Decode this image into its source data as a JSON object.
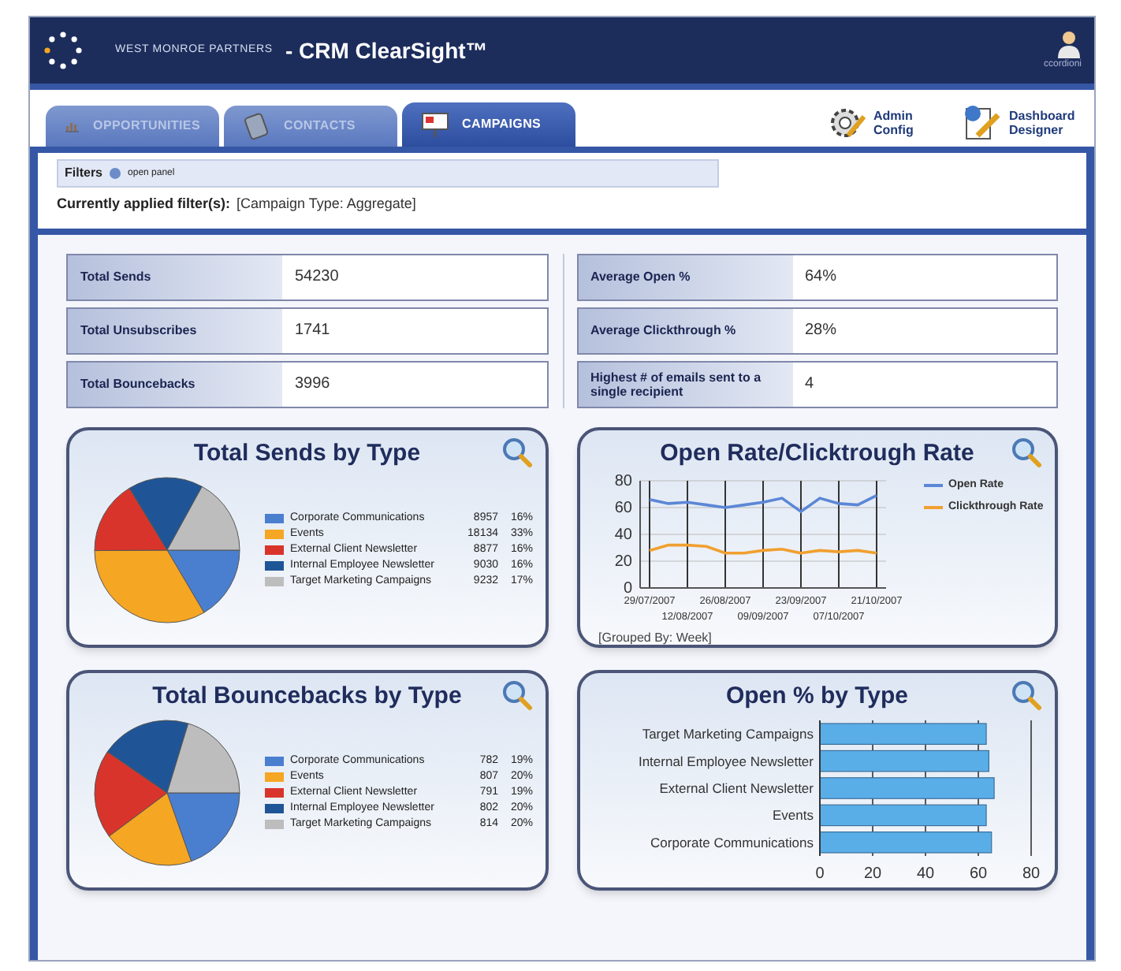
{
  "header": {
    "company": "WEST MONROE PARTNERS",
    "product": "- CRM ClearSight™",
    "user": "ccordioni"
  },
  "tabs": [
    {
      "label": "OPPORTUNITIES",
      "selected": false
    },
    {
      "label": "CONTACTS",
      "selected": false
    },
    {
      "label": "CAMPAIGNS",
      "selected": true
    }
  ],
  "tools": [
    {
      "label": "Admin Config",
      "kind": "gear"
    },
    {
      "label": "Dashboard Designer",
      "kind": "designer"
    }
  ],
  "filters": {
    "title": "Filters",
    "toggle": "open panel",
    "applied_label": "Currently applied filter(s):",
    "applied_value": "[Campaign Type: Aggregate]"
  },
  "stats_left": [
    {
      "label": "Total Sends",
      "value": "54230"
    },
    {
      "label": "Total Unsubscribes",
      "value": "1741"
    },
    {
      "label": "Total Bouncebacks",
      "value": "3996"
    }
  ],
  "stats_right": [
    {
      "label": "Average Open %",
      "value": "64%"
    },
    {
      "label": "Average Clickthrough %",
      "value": "28%"
    },
    {
      "label": "Highest # of emails sent to a single recipient",
      "value": "4"
    }
  ],
  "charts": [
    {
      "chart_data": {
        "type": "pie",
        "title": "Total Sends by Type",
        "legend": "right",
        "categories": [
          "Corporate Communications",
          "Events",
          "External Client Newsletter",
          "Internal Employee Newsletter",
          "Target Marketing Campaigns"
        ],
        "values": [
          16.5,
          33.4,
          16.4,
          16.7,
          17.0
        ],
        "colors": [
          "#4a7fd0",
          "#f5a623",
          "#d9342b",
          "#1f5596",
          "#bdbdbd"
        ]
      },
      "legend_values": [
        {
          "count": "8957",
          "share": "16%"
        },
        {
          "count": "18134",
          "share": "33%"
        },
        {
          "count": "8877",
          "share": "16%"
        },
        {
          "count": "9030",
          "share": "16%"
        },
        {
          "count": "9232",
          "share": "17%"
        }
      ]
    },
    {
      "chart_data": {
        "type": "line",
        "title": "Open Rate/Clicktrough Rate",
        "legend": "right",
        "grid": true,
        "categories": [
          "29/07/2007",
          null,
          "12/08/2007",
          null,
          "26/08/2007",
          null,
          "09/09/2007",
          null,
          "23/09/2007",
          null,
          "07/10/2007",
          null,
          "21/10/2007"
        ],
        "series": [
          {
            "name": "Open Rate",
            "color": "#5b87d6",
            "values": [
              66,
              63,
              64,
              62,
              60,
              62,
              64,
              67,
              57,
              67,
              63,
              62,
              69
            ]
          },
          {
            "name": "Clickthrough Rate",
            "color": "#f0a030",
            "values": [
              28,
              32,
              32,
              31,
              26,
              26,
              28,
              29,
              26,
              28,
              27,
              28,
              26
            ]
          }
        ],
        "ylim": [
          0,
          80
        ],
        "yticks": [
          0,
          20,
          40,
          60,
          80
        ]
      },
      "note": "[Grouped By: Week]"
    },
    {
      "chart_data": {
        "type": "pie",
        "title": "Total Bouncebacks by Type",
        "legend": "right",
        "categories": [
          "Corporate Communications",
          "Events",
          "External Client Newsletter",
          "Internal Employee Newsletter",
          "Target Marketing Campaigns"
        ],
        "values": [
          19.6,
          20.2,
          19.8,
          20.1,
          20.3
        ],
        "colors": [
          "#4a7fd0",
          "#f5a623",
          "#d9342b",
          "#1f5596",
          "#bdbdbd"
        ]
      },
      "legend_values": [
        {
          "count": "782",
          "share": "19%"
        },
        {
          "count": "807",
          "share": "20%"
        },
        {
          "count": "791",
          "share": "19%"
        },
        {
          "count": "802",
          "share": "20%"
        },
        {
          "count": "814",
          "share": "20%"
        }
      ]
    },
    {
      "chart_data": {
        "type": "bar",
        "orientation": "horizontal",
        "grid": true,
        "title": "Open % by Type",
        "categories": [
          "Target Marketing Campaigns",
          "Internal Employee Newsletter",
          "External Client Newsletter",
          "Events",
          "Corporate Communications"
        ],
        "series": [
          {
            "color": "#5aaee8",
            "values": [
              63,
              64,
              66,
              63,
              65
            ]
          }
        ],
        "xlim": [
          0,
          80
        ],
        "xticks": [
          0,
          20,
          40,
          60,
          80
        ]
      }
    }
  ]
}
